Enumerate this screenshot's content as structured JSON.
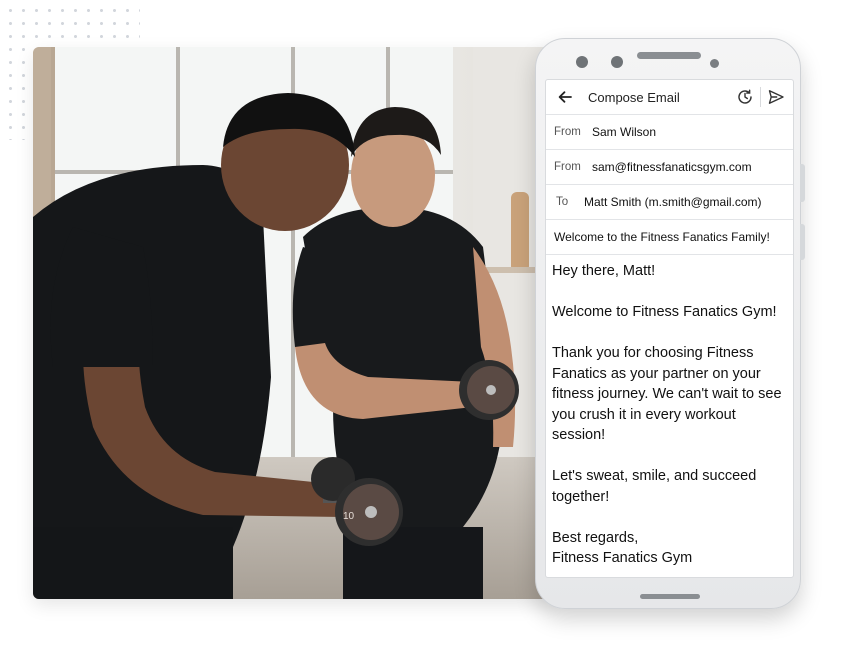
{
  "compose": {
    "title": "Compose Email",
    "from_label": "From",
    "from_name": "Sam Wilson",
    "from_label_2": "From",
    "from_email": "sam@fitnessfanaticsgym.com",
    "to_label": "To",
    "to_value": "Matt Smith (m.smith@gmail.com)",
    "subject": "Welcome to the Fitness Fanatics Family!",
    "body": {
      "greeting": "Hey there, Matt!",
      "welcome": "Welcome to Fitness Fanatics Gym!",
      "thanks": "Thank you for choosing Fitness Fanatics as your partner on your fitness journey. We can't wait to see you crush it in every workout session!",
      "motto": "Let's sweat, smile, and succeed together!",
      "signoff": "Best regards,",
      "signature": "Fitness Fanatics Gym"
    }
  },
  "icons": {
    "back": "arrow-left-icon",
    "schedule": "clock-schedule-icon",
    "send": "send-icon"
  },
  "photo": {
    "dumbbell_weight_label": "10"
  }
}
